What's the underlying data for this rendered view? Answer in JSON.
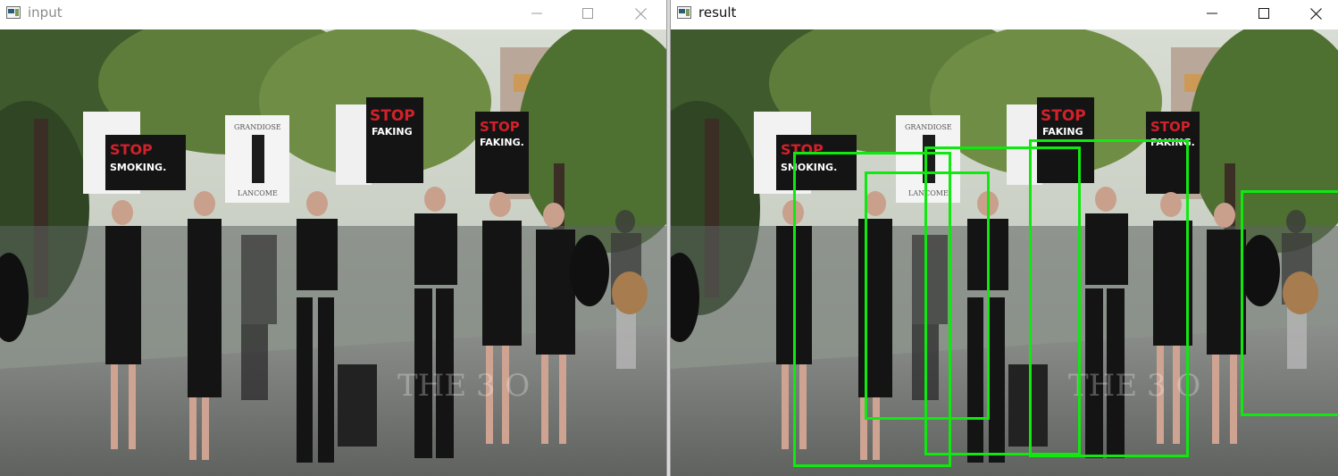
{
  "left_window": {
    "title": "input",
    "icon": "app-window-icon",
    "controls": [
      "minimize-icon",
      "maximize-icon",
      "close-icon"
    ]
  },
  "right_window": {
    "title": "result",
    "icon": "app-window-icon",
    "controls": [
      "minimize-icon",
      "maximize-icon",
      "close-icon"
    ]
  },
  "photo": {
    "signs": [
      {
        "lines": [
          "STOP",
          "SMOKING."
        ]
      },
      {
        "lines": [
          "GRANDIOSE",
          "LANCOME"
        ]
      },
      {
        "lines": [
          "STOP",
          "FAKING"
        ]
      },
      {
        "lines": [
          "STOP",
          "FAKING."
        ]
      }
    ],
    "watermark": "THE 3 O"
  },
  "detection": {
    "box_color": "#10e810",
    "box_count": 5
  }
}
